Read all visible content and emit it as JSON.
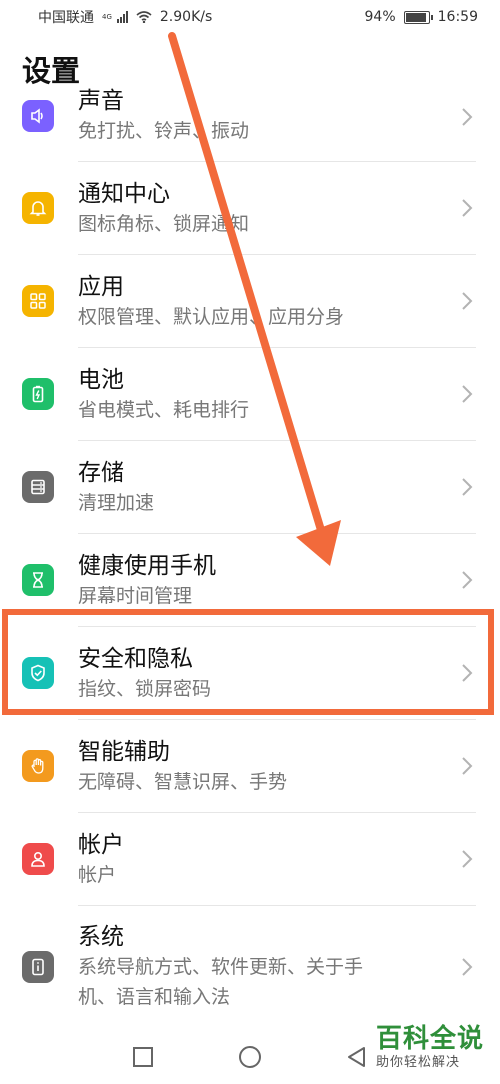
{
  "status_bar": {
    "carrier": "中国联通",
    "network_tag": "4G",
    "speed": "2.90K/s",
    "battery_percent": "94%",
    "battery_level": 0.94,
    "time": "16:59"
  },
  "page": {
    "title": "设置"
  },
  "settings": [
    {
      "title": "声音",
      "subtitle": "免打扰、铃声、振动",
      "icon": "speaker-icon",
      "color": "#7b61ff"
    },
    {
      "title": "通知中心",
      "subtitle": "图标角标、锁屏通知",
      "icon": "bell-icon",
      "color": "#f5b400"
    },
    {
      "title": "应用",
      "subtitle": "权限管理、默认应用、应用分身",
      "icon": "apps-grid-icon",
      "color": "#f5b400"
    },
    {
      "title": "电池",
      "subtitle": "省电模式、耗电排行",
      "icon": "battery-icon",
      "color": "#1fbf6a"
    },
    {
      "title": "存储",
      "subtitle": "清理加速",
      "icon": "storage-icon",
      "color": "#6b6b6b"
    },
    {
      "title": "健康使用手机",
      "subtitle": "屏幕时间管理",
      "icon": "hourglass-icon",
      "color": "#1fbf6a"
    },
    {
      "title": "安全和隐私",
      "subtitle": "指纹、锁屏密码",
      "icon": "shield-check-icon",
      "color": "#16c1b6"
    },
    {
      "title": "智能辅助",
      "subtitle": "无障碍、智慧识屏、手势",
      "icon": "hand-icon",
      "color": "#f39a1e"
    },
    {
      "title": "帐户",
      "subtitle": "帐户",
      "icon": "person-icon",
      "color": "#ef4b4b"
    },
    {
      "title": "系统",
      "subtitle": "系统导航方式、软件更新、关于手",
      "subtitle2": "机、语言和输入法",
      "icon": "phone-info-icon",
      "color": "#6b6b6b"
    }
  ],
  "watermark": {
    "main": "百科全说",
    "sub": "助你轻松解决"
  },
  "nav": {
    "square": "recent-apps-icon",
    "circle": "home-icon",
    "back": "back-icon"
  }
}
